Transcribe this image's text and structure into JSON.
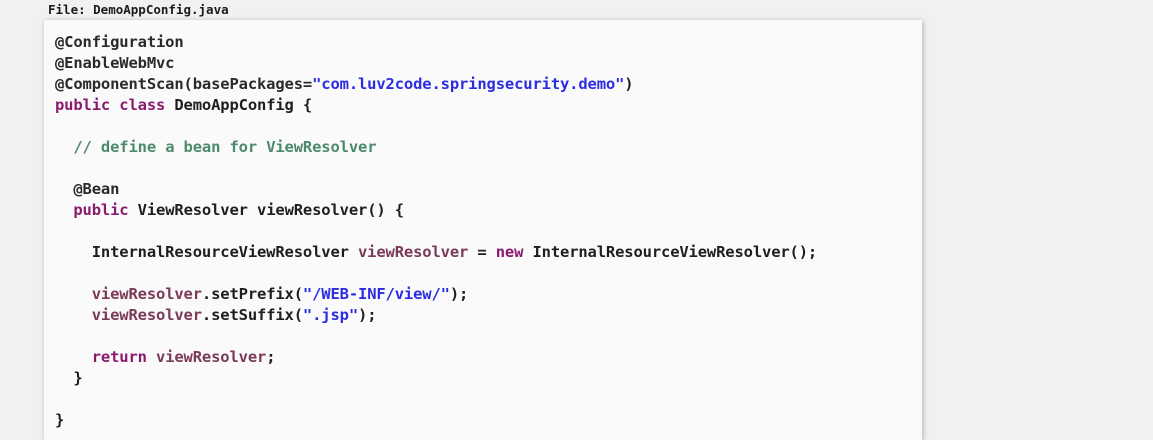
{
  "file_label": "File: DemoAppConfig.java",
  "colors": {
    "annotation": "#2a2a2a",
    "keyword": "#8a1a6e",
    "string": "#2b2de0",
    "comment": "#4c8a6c",
    "plain": "#1e1e1e",
    "variable": "#7a3a58"
  },
  "code_lines": [
    [
      {
        "t": "annotation",
        "v": "@Configuration"
      }
    ],
    [
      {
        "t": "annotation",
        "v": "@EnableWebMvc"
      }
    ],
    [
      {
        "t": "annotation",
        "v": "@ComponentScan(basePackages="
      },
      {
        "t": "string",
        "v": "\"com.luv2code.springsecurity.demo\""
      },
      {
        "t": "plain",
        "v": ")"
      }
    ],
    [
      {
        "t": "keyword",
        "v": "public class "
      },
      {
        "t": "plain",
        "v": "DemoAppConfig {"
      }
    ],
    [],
    [
      {
        "t": "plain",
        "v": "  "
      },
      {
        "t": "comment",
        "v": "// define a bean for ViewResolver"
      }
    ],
    [],
    [
      {
        "t": "plain",
        "v": "  "
      },
      {
        "t": "annotation",
        "v": "@Bean"
      }
    ],
    [
      {
        "t": "plain",
        "v": "  "
      },
      {
        "t": "keyword",
        "v": "public "
      },
      {
        "t": "plain",
        "v": "ViewResolver viewResolver() {"
      }
    ],
    [],
    [
      {
        "t": "plain",
        "v": "    InternalResourceViewResolver "
      },
      {
        "t": "variable",
        "v": "viewResolver"
      },
      {
        "t": "plain",
        "v": " = "
      },
      {
        "t": "keyword",
        "v": "new "
      },
      {
        "t": "plain",
        "v": "InternalResourceViewResolver();"
      }
    ],
    [],
    [
      {
        "t": "plain",
        "v": "    "
      },
      {
        "t": "variable",
        "v": "viewResolver"
      },
      {
        "t": "plain",
        "v": ".setPrefix("
      },
      {
        "t": "string",
        "v": "\"/WEB-INF/view/\""
      },
      {
        "t": "plain",
        "v": ");"
      }
    ],
    [
      {
        "t": "plain",
        "v": "    "
      },
      {
        "t": "variable",
        "v": "viewResolver"
      },
      {
        "t": "plain",
        "v": ".setSuffix("
      },
      {
        "t": "string",
        "v": "\".jsp\""
      },
      {
        "t": "plain",
        "v": ");"
      }
    ],
    [],
    [
      {
        "t": "plain",
        "v": "    "
      },
      {
        "t": "keyword",
        "v": "return "
      },
      {
        "t": "variable",
        "v": "viewResolver"
      },
      {
        "t": "plain",
        "v": ";"
      }
    ],
    [
      {
        "t": "plain",
        "v": "  }"
      }
    ],
    [],
    [
      {
        "t": "plain",
        "v": "}"
      }
    ]
  ]
}
